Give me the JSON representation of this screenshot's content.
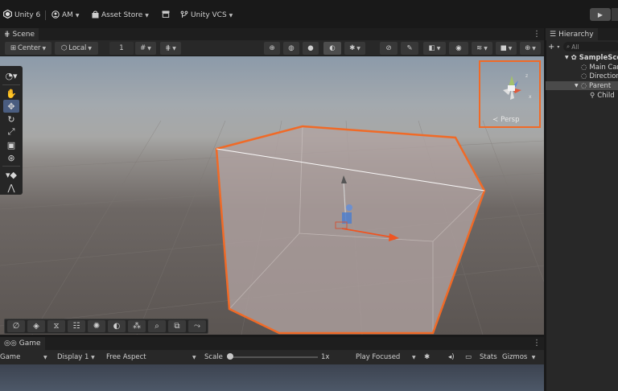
{
  "topbar": {
    "app_title": "Unity 6",
    "account": "AM",
    "asset_store": "Asset Store",
    "vcs": "Unity VCS"
  },
  "scene": {
    "tab_label": "Scene",
    "pivot_mode": "Center",
    "pivot_rotation": "Local",
    "grid_snap_value": "1",
    "camera_mode": "Persp"
  },
  "game": {
    "tab_label": "Game",
    "view_mode": "Game",
    "display": "Display 1",
    "aspect": "Free Aspect",
    "scale_label": "Scale",
    "scale_value": "1x",
    "play_mode": "Play Focused",
    "stats": "Stats",
    "gizmos": "Gizmos"
  },
  "hierarchy": {
    "tab_label": "Hierarchy",
    "search_placeholder": "All",
    "items": [
      {
        "label": "SampleScene"
      },
      {
        "label": "Main Camera"
      },
      {
        "label": "Directional Light"
      },
      {
        "label": "Parent"
      },
      {
        "label": "Child"
      }
    ]
  },
  "colors": {
    "selection_outline": "#f06a27",
    "panel_bg": "#282828",
    "topbar_bg": "#191919"
  }
}
